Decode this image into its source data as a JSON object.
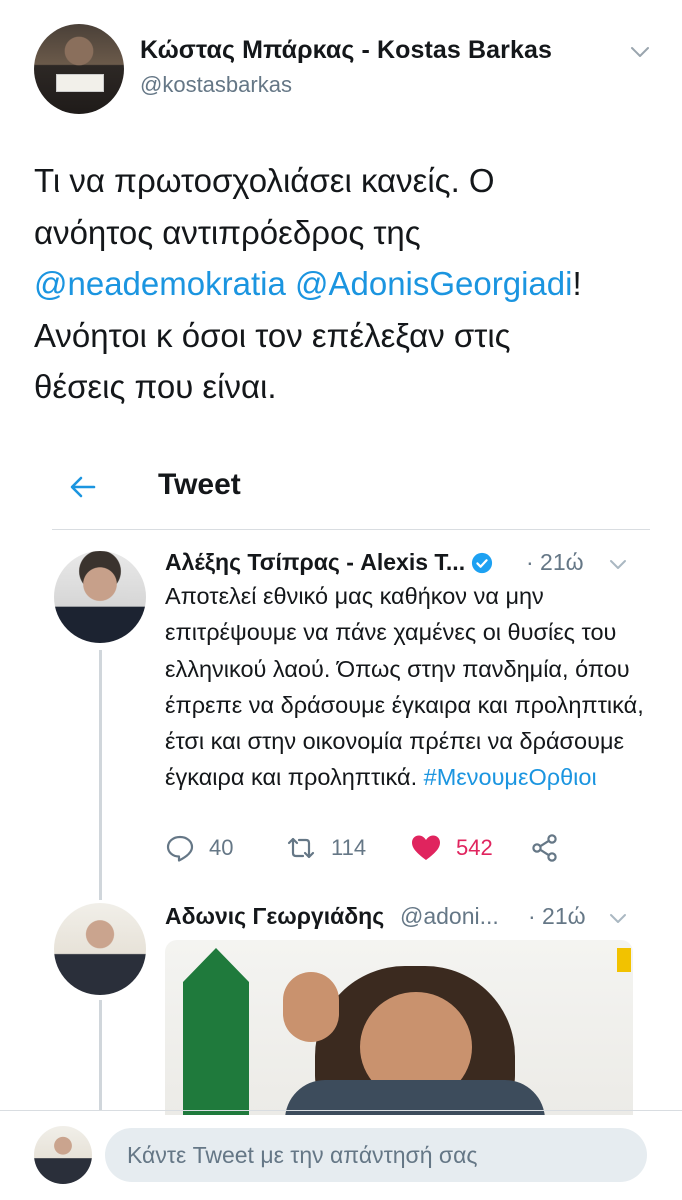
{
  "author": {
    "name": "Κώστας Μπάρκας - Kostas Barkas",
    "handle": "@kostasbarkas"
  },
  "tweet": {
    "line1": "Τι να πρωτοσχολιάσει κανείς. Ο",
    "line2": "ανόητος αντιπρόεδρος της",
    "mention1": "@neademokratia",
    "mention2": "@AdonisGeorgiadi",
    "line3_tail": "!",
    "line4": "Ανόητοι κ όσοι τον επέλεξαν στις",
    "line5": "θέσεις που είναι."
  },
  "embed": {
    "nav_title": "Tweet",
    "tweet1": {
      "name": "Αλέξης Τσίπρας - Alexis T...",
      "time": "· 21ώ",
      "text": "Αποτελεί εθνικό μας καθήκον να μην επιτρέψουμε να πάνε χαμένες οι θυσίες του ελληνικού λαού. Όπως στην πανδημία, όπου έπρεπε να δράσουμε έγκαιρα και προληπτικά, έτσι και στην οικονομία πρέπει να δράσουμε έγκαιρα και προληπτικά.",
      "hashtag": "#ΜενουμεΟρθιοι",
      "replies": "40",
      "retweets": "114",
      "likes": "542"
    },
    "tweet2": {
      "name": "Αδωνις Γεωργιάδης",
      "handle": "@adoni...",
      "time": "· 21ώ"
    }
  },
  "reply": {
    "placeholder": "Κάντε Tweet με την απάντησή σας"
  },
  "colors": {
    "link": "#1b95e0",
    "secondary": "#657786",
    "like": "#e0245e"
  }
}
